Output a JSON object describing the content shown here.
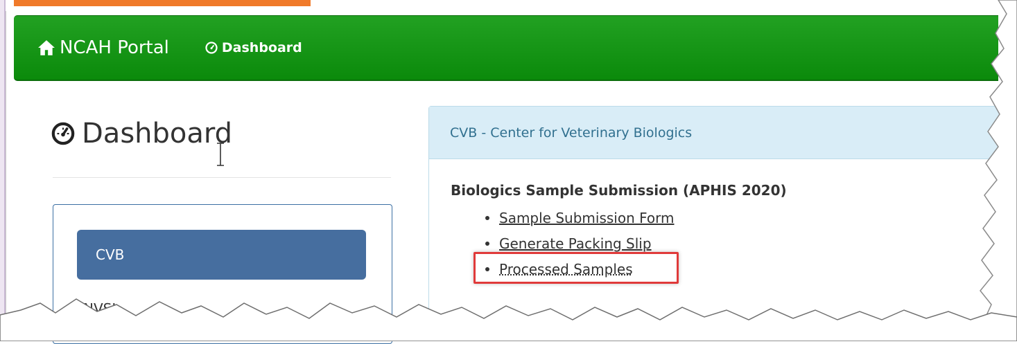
{
  "navbar": {
    "brand_label": "NCAH Portal",
    "brand_icon": "home-icon",
    "dashboard_link_label": "Dashboard",
    "dashboard_icon": "dashboard-gauge-icon",
    "color": "#0b8a0b"
  },
  "page": {
    "title": "Dashboard",
    "title_icon": "dashboard-gauge-icon"
  },
  "sidebar": {
    "items": [
      {
        "label": "CVB",
        "active": true
      },
      {
        "label": "NVSL",
        "active": false
      }
    ],
    "active_color": "#466e9f"
  },
  "card": {
    "header": "CVB - Center for Veterinary Biologics",
    "section_heading": "Biologics Sample Submission (APHIS 2020)",
    "links": [
      {
        "label": "Sample Submission Form"
      },
      {
        "label": "Generate Packing Slip"
      },
      {
        "label": "Processed Samples",
        "highlighted": true
      }
    ]
  },
  "annotation": {
    "highlight_color": "#e03a3a"
  },
  "accent_color": "#f07a2a"
}
